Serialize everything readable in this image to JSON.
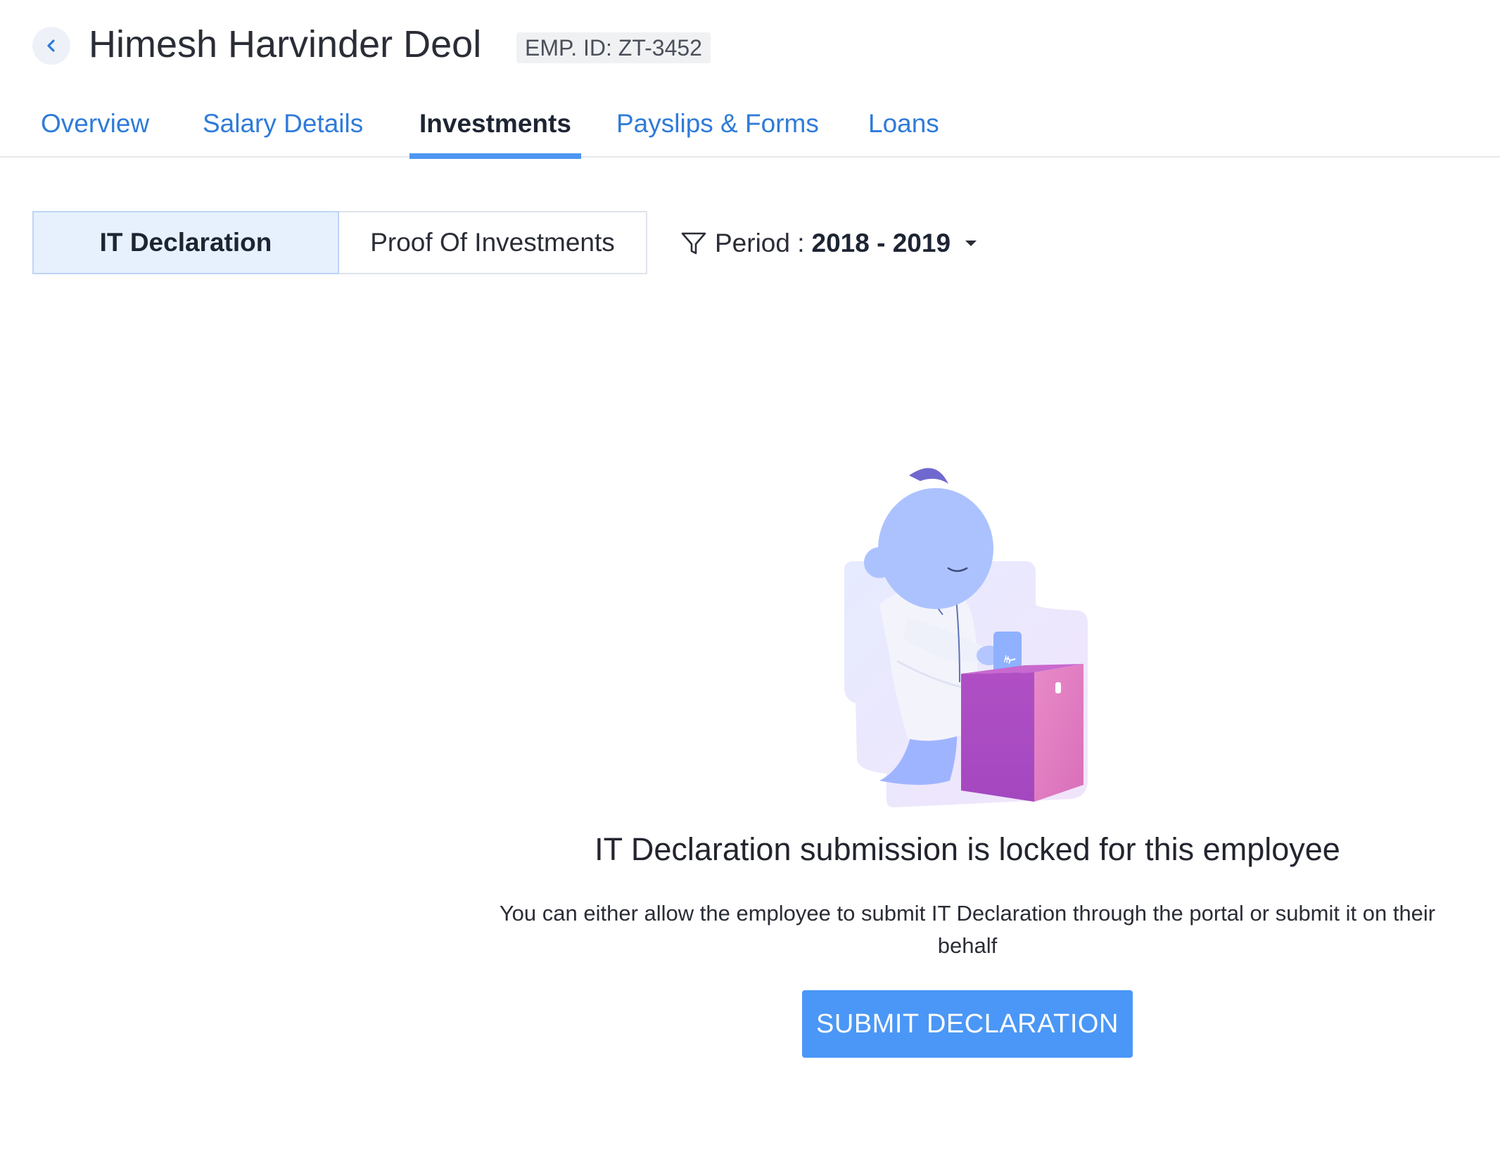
{
  "header": {
    "back_icon": "chevron-left-icon",
    "employee_name": "Himesh Harvinder Deol",
    "employee_id": "EMP. ID: ZT-3452"
  },
  "tabs": [
    {
      "label": "Overview",
      "active": false
    },
    {
      "label": "Salary Details",
      "active": false
    },
    {
      "label": "Investments",
      "active": true
    },
    {
      "label": "Payslips & Forms",
      "active": false
    },
    {
      "label": "Loans",
      "active": false
    }
  ],
  "segment": {
    "it_declaration": "IT Declaration",
    "proof_of_investments": "Proof Of Investments"
  },
  "period": {
    "icon": "filter-icon",
    "label": "Period :",
    "value": "2018 - 2019",
    "dropdown_icon": "caret-down-icon"
  },
  "empty_state": {
    "title": "IT Declaration submission is locked for this employee",
    "description": "You can either allow the employee to submit IT Declaration through the portal or submit it on their behalf",
    "button_label": "SUBMIT DECLARATION"
  },
  "colors": {
    "accent": "#4a97f7",
    "link": "#2f7bd9",
    "tab_indicator": "#4f96f0",
    "segment_active_bg": "#e7f1fe"
  }
}
